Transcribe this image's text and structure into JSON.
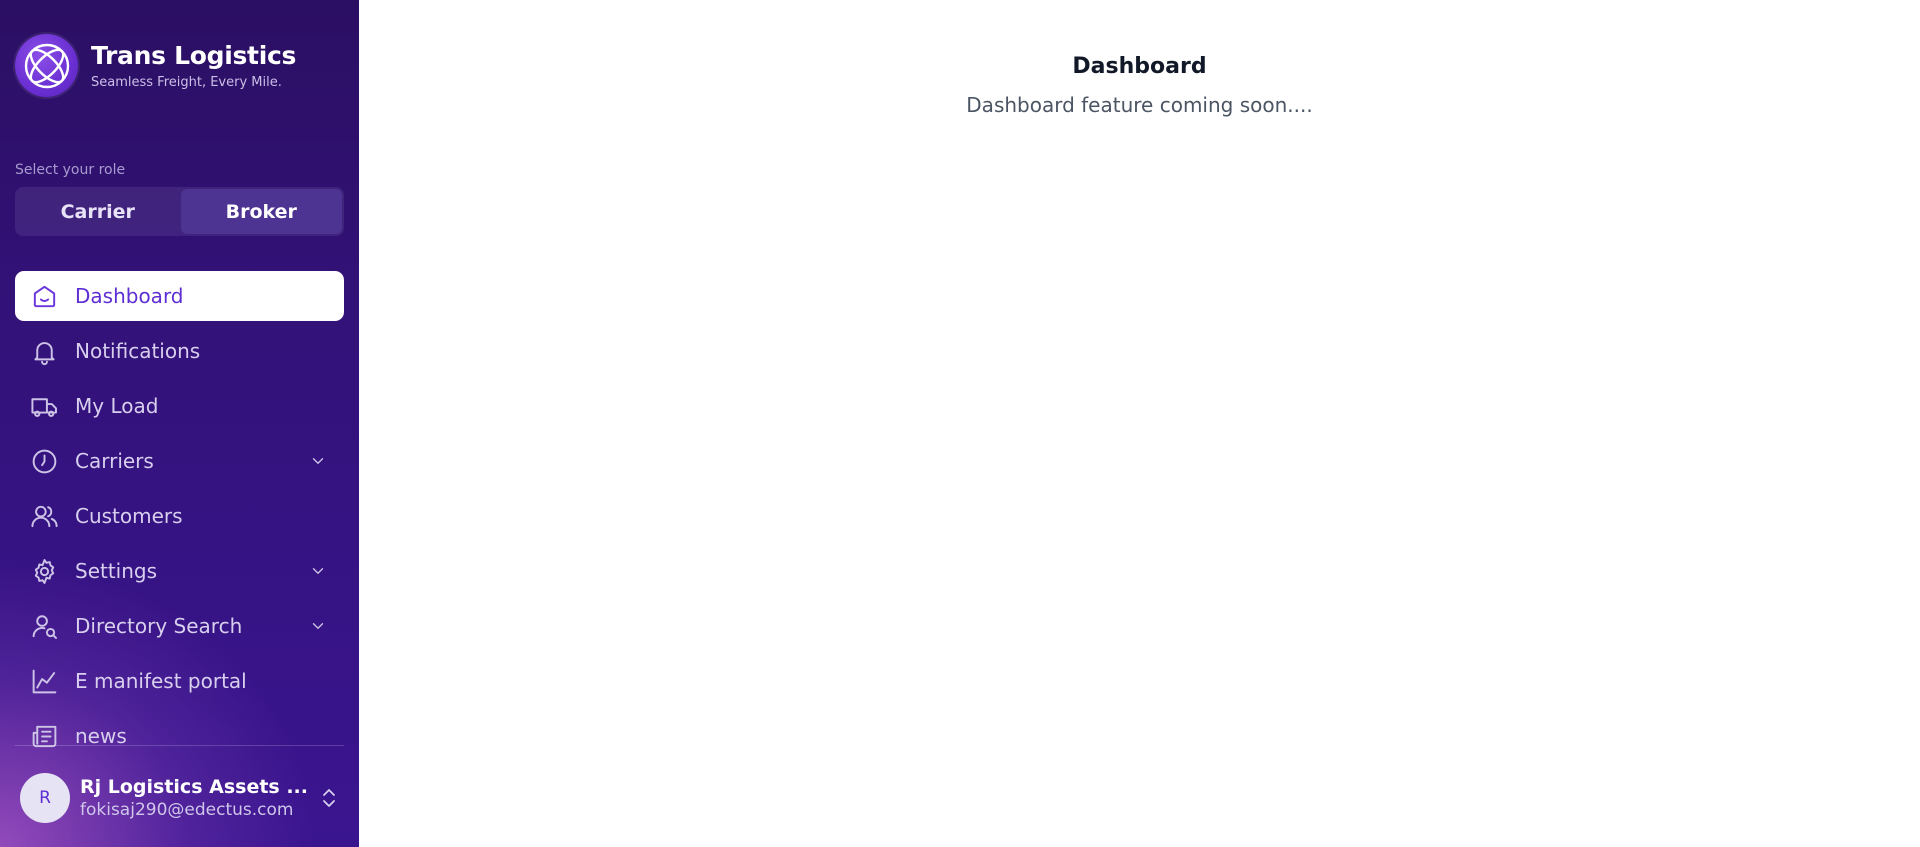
{
  "brand": {
    "title": "Trans Logistics",
    "tagline": "Seamless Freight, Every Mile.",
    "logo_icon": "globe-lattice-icon"
  },
  "role": {
    "label": "Select your role",
    "options": [
      "Carrier",
      "Broker"
    ],
    "selected": "Broker"
  },
  "nav": {
    "items": [
      {
        "label": "Dashboard",
        "icon": "home-icon",
        "active": true,
        "expandable": false
      },
      {
        "label": "Notifications",
        "icon": "bell-icon",
        "active": false,
        "expandable": false
      },
      {
        "label": "My Load",
        "icon": "truck-icon",
        "active": false,
        "expandable": false
      },
      {
        "label": "Carriers",
        "icon": "clock-icon",
        "active": false,
        "expandable": true
      },
      {
        "label": "Customers",
        "icon": "users-icon",
        "active": false,
        "expandable": false
      },
      {
        "label": "Settings",
        "icon": "gear-icon",
        "active": false,
        "expandable": true
      },
      {
        "label": "Directory Search",
        "icon": "user-search-icon",
        "active": false,
        "expandable": true
      },
      {
        "label": "E manifest portal",
        "icon": "line-chart-icon",
        "active": false,
        "expandable": false
      },
      {
        "label": "news",
        "icon": "newspaper-icon",
        "active": false,
        "expandable": false
      }
    ]
  },
  "user": {
    "initial": "R",
    "name": "Rj Logistics Assets ...",
    "email": "fokisaj290@edectus.com"
  },
  "main": {
    "title": "Dashboard",
    "subtitle": "Dashboard feature coming soon...."
  },
  "colors": {
    "sidebar_bg": "#2b0f63",
    "accent": "#5d2ed3",
    "active_role_bg": "#4d3392"
  }
}
